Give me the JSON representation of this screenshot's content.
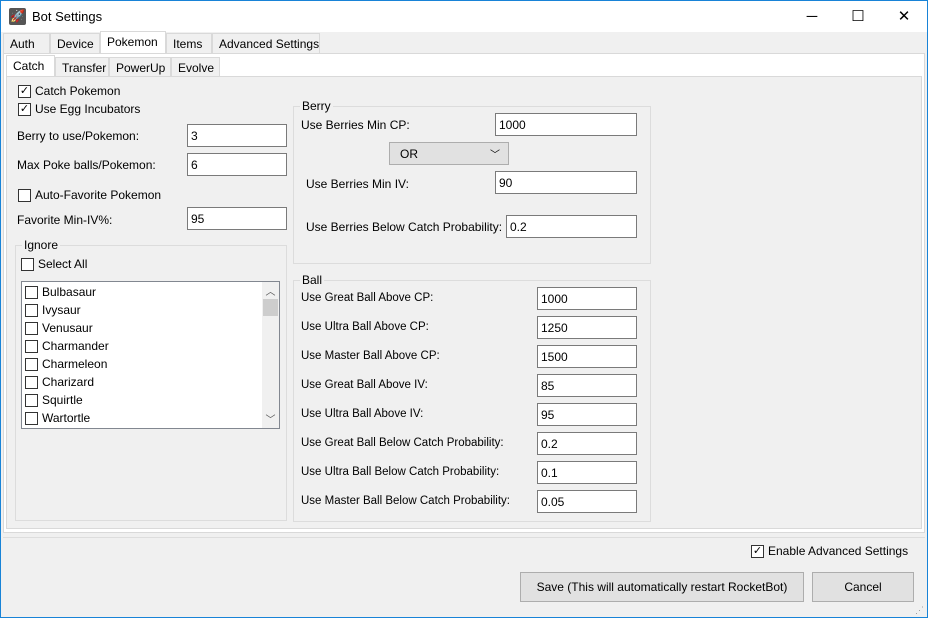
{
  "window": {
    "title": "Bot Settings",
    "minimize": "─",
    "maximize": "☐",
    "close": "✕"
  },
  "tabs": [
    "Auth",
    "Device",
    "Pokemon",
    "Items",
    "Advanced Settings"
  ],
  "subtabs": [
    "Catch",
    "Transfer",
    "PowerUp",
    "Evolve"
  ],
  "catch": {
    "catch_pokemon": {
      "label": "Catch Pokemon",
      "checked": true
    },
    "use_egg": {
      "label": "Use Egg Incubators",
      "checked": true
    },
    "berry_label": "Berry  to use/Pokemon:",
    "berry_value": "3",
    "balls_label": "Max Poke balls/Pokemon:",
    "balls_value": "6",
    "auto_fav": {
      "label": "Auto-Favorite Pokemon",
      "checked": false
    },
    "fav_label": "Favorite Min-IV%:",
    "fav_value": "95",
    "ignore": {
      "title": "Ignore",
      "select_all": "Select All",
      "items": [
        "Bulbasaur",
        "Ivysaur",
        "Venusaur",
        "Charmander",
        "Charmeleon",
        "Charizard",
        "Squirtle",
        "Wartortle"
      ]
    }
  },
  "berry": {
    "title": "Berry",
    "min_cp_label": "Use Berries Min CP:",
    "min_cp": "1000",
    "op": "OR",
    "min_iv_label": "Use Berries Min IV:",
    "min_iv": "90",
    "below_label": "Use Berries Below Catch Probability:",
    "below": "0.2"
  },
  "ball": {
    "title": "Ball",
    "rows": [
      {
        "label": "Use Great Ball Above CP:",
        "value": "1000"
      },
      {
        "label": "Use Ultra Ball Above CP:",
        "value": "1250"
      },
      {
        "label": "Use Master Ball Above CP:",
        "value": "1500"
      },
      {
        "label": "Use Great Ball Above IV:",
        "value": "85"
      },
      {
        "label": "Use Ultra Ball Above IV:",
        "value": "95"
      },
      {
        "label": "Use Great Ball  Below Catch Probability:",
        "value": "0.2"
      },
      {
        "label": "Use Ultra Ball Below Catch Probability:",
        "value": "0.1"
      },
      {
        "label": "Use Master Ball Below Catch Probability:",
        "value": "0.05"
      }
    ]
  },
  "footer": {
    "advanced": "Enable Advanced Settings",
    "save": "Save (This will automatically restart RocketBot)",
    "cancel": "Cancel"
  }
}
